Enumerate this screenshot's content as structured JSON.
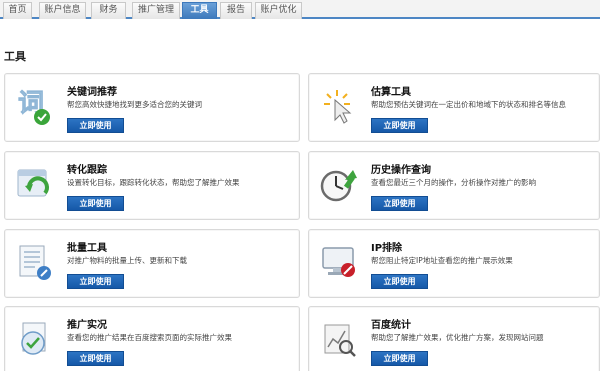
{
  "tabs": [
    {
      "label": "首页"
    },
    {
      "label": "账户信息"
    },
    {
      "label": "财务"
    },
    {
      "label": "推广管理"
    },
    {
      "label": "工具"
    },
    {
      "label": "报告"
    },
    {
      "label": "账户优化"
    }
  ],
  "section": {
    "title": "工具"
  },
  "tools": [
    {
      "title": "关键词推荐",
      "desc": "帮您高效快捷地找到更多适合您的关键词",
      "button": "立即使用",
      "icon": "keyword-icon"
    },
    {
      "title": "估算工具",
      "desc": "帮助您预估关键词在一定出价和地域下的状态和排名等信息",
      "button": "立即使用",
      "icon": "estimate-icon"
    },
    {
      "title": "转化跟踪",
      "desc": "设置转化目标，跟踪转化状态，帮助您了解推广效果",
      "button": "立即使用",
      "icon": "conversion-icon"
    },
    {
      "title": "历史操作查询",
      "desc": "查看您最近三个月的操作，分析操作对推广的影响",
      "button": "立即使用",
      "icon": "history-clock-icon"
    },
    {
      "title": "批量工具",
      "desc": "对推广物料的批量上传、更新和下载",
      "button": "立即使用",
      "icon": "batch-icon"
    },
    {
      "title": "IP排除",
      "desc": "帮您阻止特定IP地址查看您的推广展示效果",
      "button": "立即使用",
      "icon": "ip-exclude-icon"
    },
    {
      "title": "推广实况",
      "desc": "查看您的推广结果在百度搜索页面的实际推广效果",
      "button": "立即使用",
      "icon": "live-view-icon"
    },
    {
      "title": "百度统计",
      "desc": "帮助您了解推广效果，优化推广方案，发现网站问题",
      "button": "立即使用",
      "icon": "statistics-icon"
    }
  ]
}
